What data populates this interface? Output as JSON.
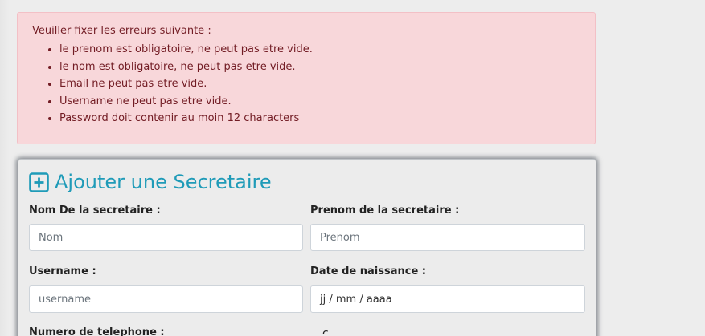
{
  "alert": {
    "title": "Veuiller fixer les erreurs suivante :",
    "errors": [
      "le prenom est obligatoire, ne peut pas etre vide.",
      "le nom est obligatoire, ne peut pas etre vide.",
      "Email ne peut pas etre vide.",
      "Username ne peut pas etre vide.",
      "Password doit contenir au moin 12 characters"
    ],
    "color": "#721c24",
    "background": "#f8d7da"
  },
  "form": {
    "title": "Ajouter une Secretaire",
    "title_icon": "plus-square-icon",
    "accent_color": "#1f9bb8",
    "nom_label": "Nom De la secretaire :",
    "nom_placeholder": "Nom",
    "prenom_label": "Prenom de la secretaire :",
    "prenom_placeholder": "Prenom",
    "username_label": "Username :",
    "username_placeholder": "username",
    "date_label": "Date de naissance :",
    "date_placeholder": "jj / mm / aaaa",
    "telephone_label": "Numero de telephone :"
  }
}
